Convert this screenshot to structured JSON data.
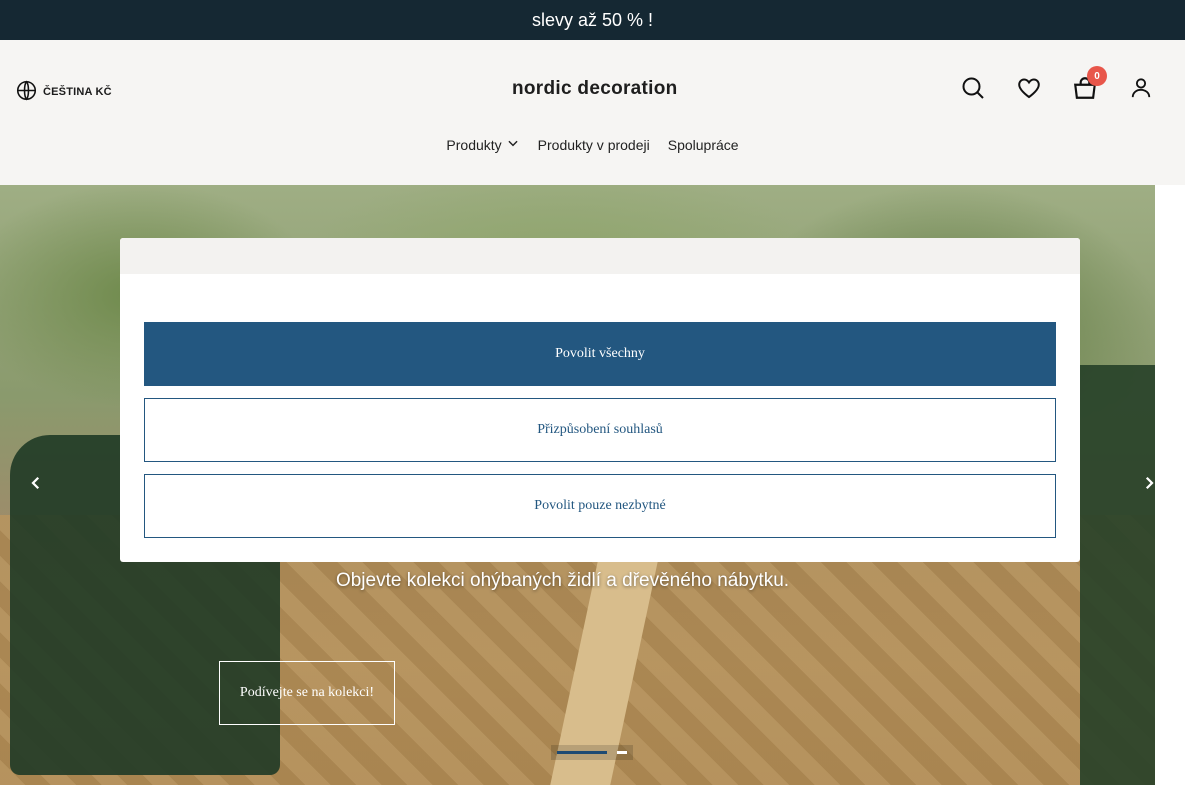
{
  "promo": {
    "text": "slevy až 50 % !"
  },
  "header": {
    "locale": "ČEŠTINA KČ",
    "logo": "nordic decoration",
    "cart_count": "0",
    "icons": [
      "globe-icon",
      "search-icon",
      "heart-icon",
      "bag-icon",
      "user-icon"
    ]
  },
  "nav": {
    "items": [
      {
        "label": "Produkty",
        "has_dropdown": true
      },
      {
        "label": "Produkty v prodeji"
      },
      {
        "label": "Spolupráce"
      }
    ]
  },
  "hero": {
    "subtitle": "Objevte kolekci ohýbaných židlí a dřevěného nábytku.",
    "cta": "Podívejte se na kolekci!",
    "slide_active": 1,
    "slide_count": 2
  },
  "consent": {
    "allow_all": "Povolit všechny",
    "customize": "Přizpůsobení souhlasů",
    "necessary_only": "Povolit pouze nezbytné"
  },
  "colors": {
    "promo_bg": "#152833",
    "primary": "#235780",
    "badge": "#e8564a"
  }
}
